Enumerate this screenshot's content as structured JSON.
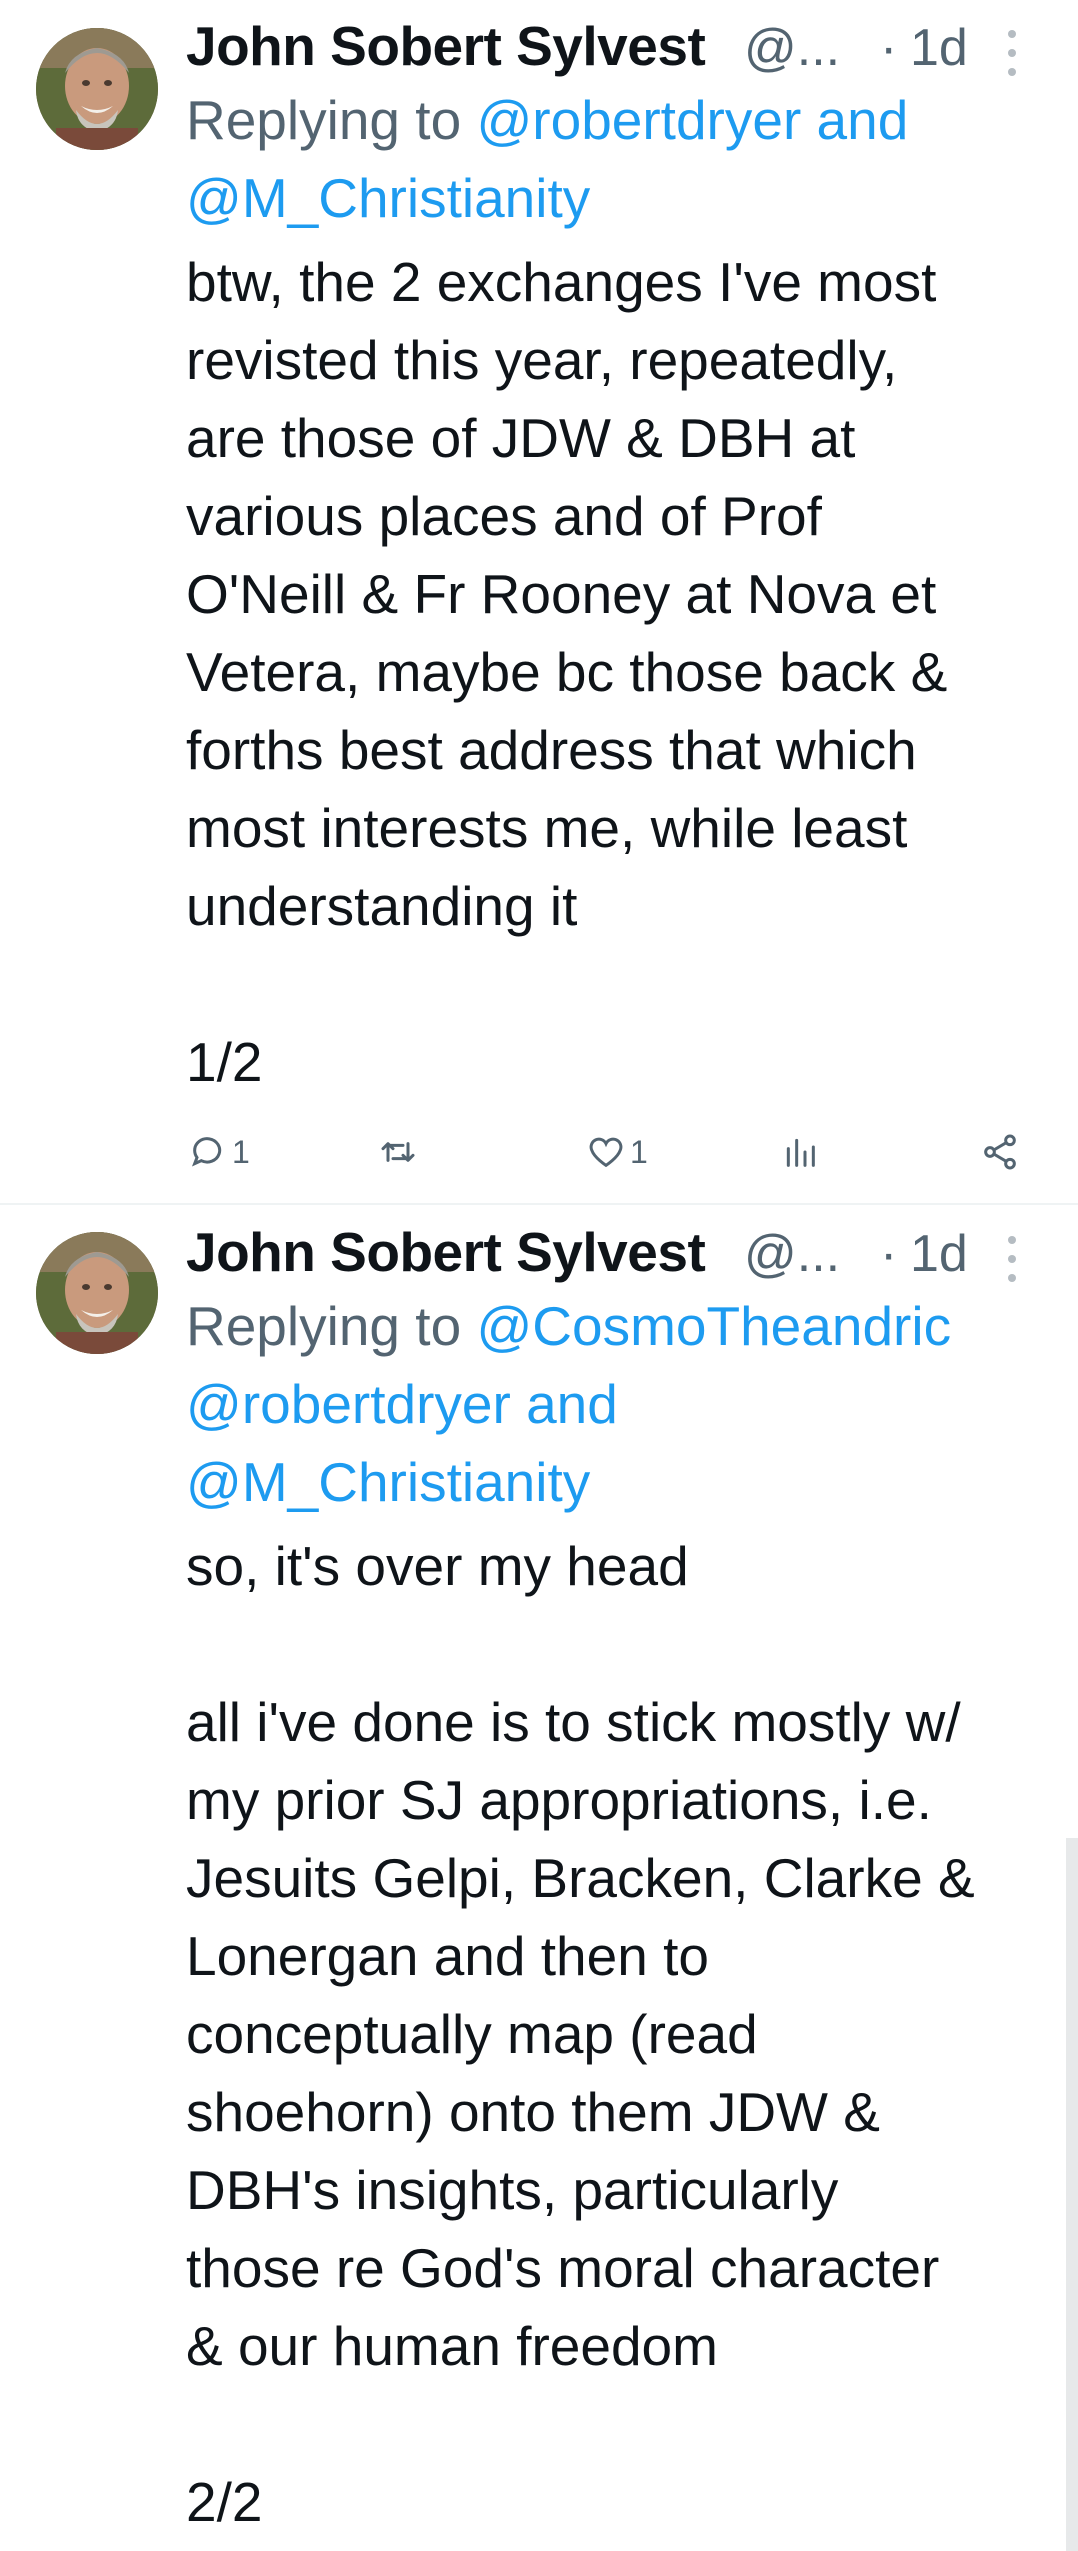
{
  "tweets": [
    {
      "author_name": "John Sobert Sylvest",
      "author_handle": "@...",
      "time": "1d",
      "replying_prefix": "Replying to ",
      "reply_mentions_line1": "@robertdryer and",
      "reply_mentions_line2": "@M_Christianity",
      "body_lines": [
        "btw, the 2 exchanges I've most",
        "revisted this year, repeatedly,",
        "are those of JDW & DBH at",
        "various places and of Prof",
        "O'Neill & Fr Rooney at Nova et",
        "Vetera, maybe bc those back &",
        "forths best address that which",
        "most interests me, while least",
        "understanding it",
        "1/2"
      ],
      "reply_count": "1",
      "like_count": "1"
    },
    {
      "author_name": "John Sobert Sylvest",
      "author_handle": "@...",
      "time": "1d",
      "replying_prefix": "Replying to ",
      "reply_mentions_line1": "@CosmoTheandric",
      "reply_mentions_line2": "@robertdryer and",
      "reply_mentions_line3": "@M_Christianity",
      "body_lines": [
        "so, it's over my head",
        "all i've done is to stick mostly w/",
        "my prior SJ appropriations, i.e.",
        "Jesuits Gelpi, Bracken, Clarke &",
        "Lonergan and then to",
        "conceptually map (read",
        "shoehorn) onto them JDW &",
        "DBH's insights, particularly",
        "those re God's moral character",
        "& our human freedom",
        "2/2"
      ]
    }
  ],
  "separator_dot": "·",
  "icons": {
    "reply": "reply-icon",
    "retweet": "retweet-icon",
    "like": "like-icon",
    "views": "views-icon",
    "share": "share-icon",
    "more": "more-vertical-icon"
  }
}
